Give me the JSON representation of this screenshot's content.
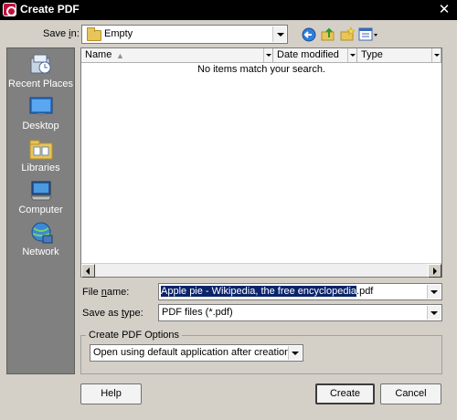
{
  "window": {
    "title": "Create PDF"
  },
  "save_in": {
    "label_prefix": "Save ",
    "label_accel": "i",
    "label_suffix": "n:",
    "value": "Empty"
  },
  "toolbar": {
    "icons": [
      "back-icon",
      "up-folder-icon",
      "new-folder-icon",
      "view-menu-icon"
    ]
  },
  "places": [
    {
      "label": "Recent Places",
      "icon": "recent-places-icon"
    },
    {
      "label": "Desktop",
      "icon": "desktop-icon"
    },
    {
      "label": "Libraries",
      "icon": "libraries-icon"
    },
    {
      "label": "Computer",
      "icon": "computer-icon"
    },
    {
      "label": "Network",
      "icon": "network-icon"
    }
  ],
  "file_list": {
    "columns": [
      "Name",
      "Date modified",
      "Type"
    ],
    "empty_message": "No items match your search."
  },
  "file_name": {
    "label_prefix": "File ",
    "label_accel": "n",
    "label_suffix": "ame:",
    "selected_value": "Apple pie - Wikipedia, the free encyclopedia",
    "extension": ".pdf"
  },
  "save_as_type": {
    "label_prefix": "Save as ",
    "label_accel": "t",
    "label_suffix": "ype:",
    "value": "PDF files (*.pdf)"
  },
  "options": {
    "group_title": "Create PDF Options",
    "selected": "Open using default application after creation"
  },
  "buttons": {
    "help": "Help",
    "create": "Create",
    "cancel": "Cancel"
  }
}
